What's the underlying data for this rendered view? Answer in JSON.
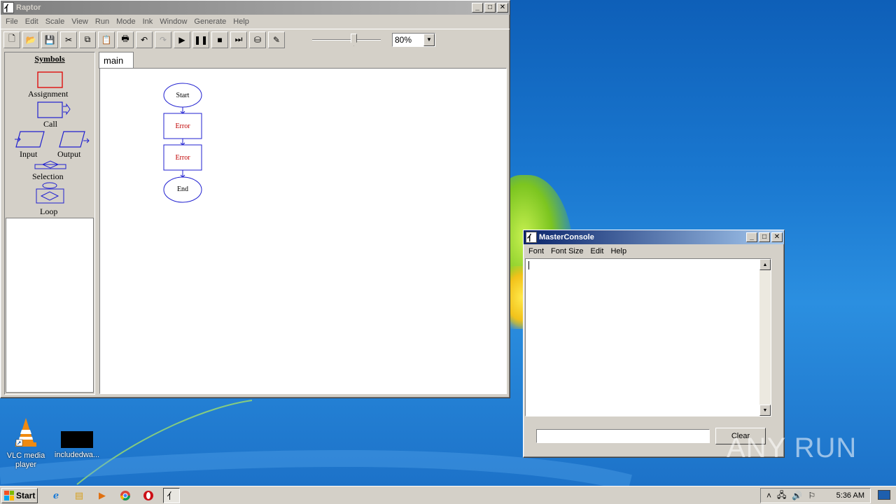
{
  "raptor": {
    "title": "Raptor",
    "menu": [
      "File",
      "Edit",
      "Scale",
      "View",
      "Run",
      "Mode",
      "Ink",
      "Window",
      "Generate",
      "Help"
    ],
    "zoom": "80%",
    "zoom_slider_fraction": 0.6,
    "symbols_title": "Symbols",
    "symbols": {
      "assignment": "Assignment",
      "call": "Call",
      "input": "Input",
      "output": "Output",
      "selection": "Selection",
      "loop": "Loop"
    },
    "tab": "main",
    "flowchart": {
      "start": "Start",
      "step1": "Error",
      "step2": "Error",
      "end": "End"
    }
  },
  "console": {
    "title": "MasterConsole",
    "menu": [
      "Font",
      "Font Size",
      "Edit",
      "Help"
    ],
    "input_value": "",
    "clear_label": "Clear"
  },
  "desktop": {
    "icons": [
      {
        "label": "VLC media player"
      },
      {
        "label": "includedwa..."
      }
    ]
  },
  "watermark": "ANY RUN",
  "taskbar": {
    "start_label": "Start",
    "clock": "5:36 AM"
  },
  "colors": {
    "error_text": "#c00000",
    "flow_blue": "#2020d0",
    "assignment_red": "#e00000"
  }
}
